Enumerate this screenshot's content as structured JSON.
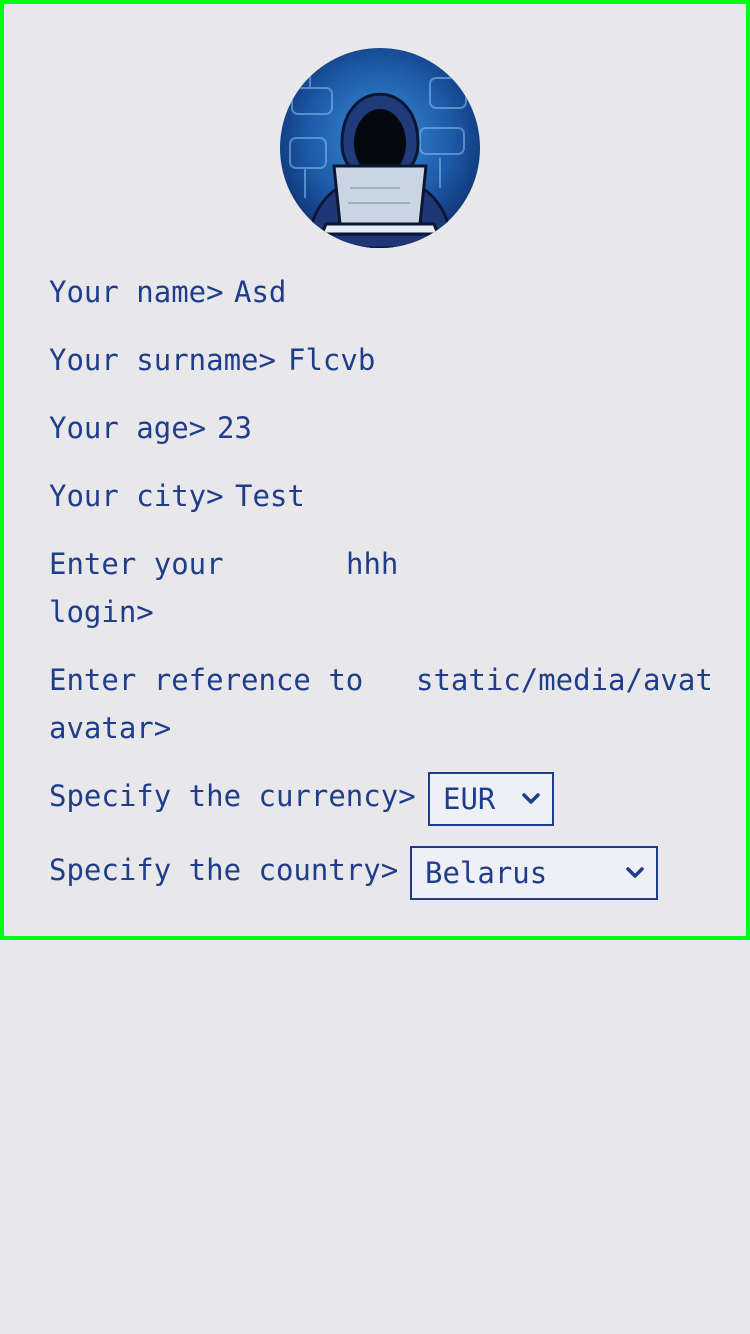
{
  "profile": {
    "avatar_icon": "hooded-hacker-avatar-icon",
    "name_label": "Your name>",
    "name_value": "Asd",
    "surname_label": "Your surname>",
    "surname_value": "Flcvb",
    "age_label": "Your age>",
    "age_value": "23",
    "city_label": "Your city>",
    "city_value": "Test",
    "login_label_line1": "Enter your",
    "login_label_line2": "login>",
    "login_value": "hhh",
    "avatar_ref_label_line1": "Enter reference to",
    "avatar_ref_label_line2": "avatar>",
    "avatar_ref_value": "static/media/avat",
    "currency_label": "Specify the currency>",
    "currency_selected": "EUR",
    "country_label": "Specify the country>",
    "country_selected": "Belarus"
  },
  "colors": {
    "text": "#1f3d8a",
    "border": "#00ff10",
    "background": "#e8e8ea"
  }
}
